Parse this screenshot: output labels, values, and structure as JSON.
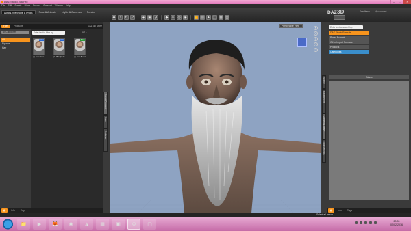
{
  "window": {
    "title": "DAZ Studio 4.6 Pro",
    "controls": [
      "–",
      "□",
      "×"
    ]
  },
  "menu": [
    "File",
    "Edit",
    "Create",
    "Show",
    "Render",
    "Connect",
    "Window",
    "Help"
  ],
  "rooms": [
    "Actors, Wardrobe & Props",
    "Pose & Animate",
    "Lights & Cameras",
    "Render"
  ],
  "brand": {
    "text": "DAZ",
    "num": "3D"
  },
  "top_links": [
    "Feedback",
    "My Account"
  ],
  "left_panel": {
    "tabs": [
      "Files",
      "Products"
    ],
    "store_link": "DAZ 3D Store",
    "dropdown": "All Categories",
    "items": [
      "All",
      "Figures",
      "Hair"
    ],
    "search_placeholder": "Enter text to filter by...",
    "page": "1 / 1",
    "thumbs": [
      {
        "caption": "(5) New Waist-Sh",
        "badge": "Active"
      },
      {
        "caption": "(2) !Bits (Default) Bar",
        "badge": "Active"
      },
      {
        "caption": "(1) New Beard-Sh",
        "badge": "New"
      }
    ],
    "bottom_tabs": [
      "Info",
      "Tags"
    ]
  },
  "side_tabs_left": [
    "Smart Content",
    "Sets",
    "Surfaces"
  ],
  "viewport": {
    "tabs": [
      "DAZ Studio"
    ],
    "perspective": "Perspective View"
  },
  "right_panel": {
    "search_placeholder": "Enter text to search by...",
    "items": [
      {
        "label": "DAZ Studio Formats",
        "state": "sel"
      },
      {
        "label": "Poser Formats",
        "state": ""
      },
      {
        "label": "Other Import Formats",
        "state": ""
      },
      {
        "label": "Products",
        "state": ""
      },
      {
        "label": "Categories",
        "state": "sub"
      }
    ],
    "table_header": "Name",
    "bottom_tabs": [
      "Info",
      "Tags"
    ]
  },
  "side_tabs_right": [
    "Content Library",
    "Parameters",
    "Scene",
    "Tool Settings"
  ],
  "status": {
    "lesson": "Select a Lesson..."
  },
  "clock": {
    "time": "20:39",
    "date": "05/02/2016"
  },
  "colors": {
    "accent": "#f7941d",
    "viewport": "#8ea3c2",
    "taskbar": "#d58ab9"
  }
}
